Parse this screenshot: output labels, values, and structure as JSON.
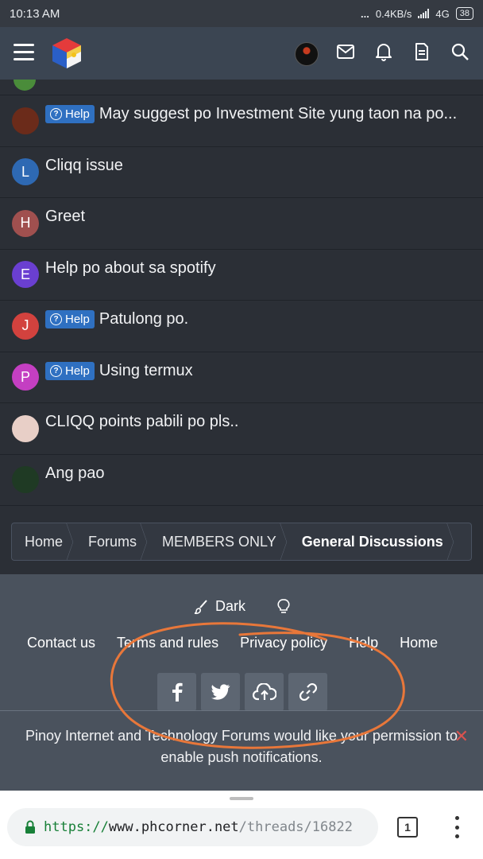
{
  "status_bar": {
    "time": "10:13 AM",
    "dots": "...",
    "net_speed": "0.4KB/s",
    "network": "4G",
    "battery": "38"
  },
  "nav": {
    "icons": [
      "menu-icon",
      "site-logo",
      "user-avatar",
      "envelope-icon",
      "bell-icon",
      "document-icon",
      "search-icon"
    ]
  },
  "threads": [
    {
      "title": "May suggest po Investment Site yung taon na po...",
      "prefix": "Help",
      "avatar_letter": "",
      "avatar_color": "#6b2b1a"
    },
    {
      "title": "Cliqq issue",
      "prefix": "",
      "avatar_letter": "L",
      "avatar_color": "#2e69b3"
    },
    {
      "title": "Greet",
      "prefix": "",
      "avatar_letter": "H",
      "avatar_color": "#a0504f"
    },
    {
      "title": "Help po about sa spotify",
      "prefix": "",
      "avatar_letter": "E",
      "avatar_color": "#6a3fd1"
    },
    {
      "title": "Patulong po.",
      "prefix": "Help",
      "avatar_letter": "J",
      "avatar_color": "#d2423e"
    },
    {
      "title": "Using termux",
      "prefix": "Help",
      "avatar_letter": "P",
      "avatar_color": "#c43fc2"
    },
    {
      "title": "CLIQQ points pabili po pls..",
      "prefix": "",
      "avatar_letter": "",
      "avatar_color": "#e8cfc7"
    },
    {
      "title": "Ang pao",
      "prefix": "",
      "avatar_letter": "",
      "avatar_color": "#1f3a24"
    }
  ],
  "breadcrumb": [
    "Home",
    "Forums",
    "MEMBERS ONLY",
    "General Discussions"
  ],
  "footer": {
    "style_label": "Dark",
    "links": [
      "Contact us",
      "Terms and rules",
      "Privacy policy",
      "Help",
      "Home"
    ],
    "social": [
      "facebook-icon",
      "twitter-icon",
      "upload-cloud-icon",
      "link-icon"
    ],
    "push_message": "Pinoy Internet and Technology Forums would like your permission to enable push notifications."
  },
  "browser": {
    "url_scheme": "https://",
    "url_host": "www.phcorner.net",
    "url_path": "/threads/16822",
    "tab_count": "1"
  },
  "colors": {
    "accent": "#2f70c1",
    "annotation": "#e8773a"
  }
}
